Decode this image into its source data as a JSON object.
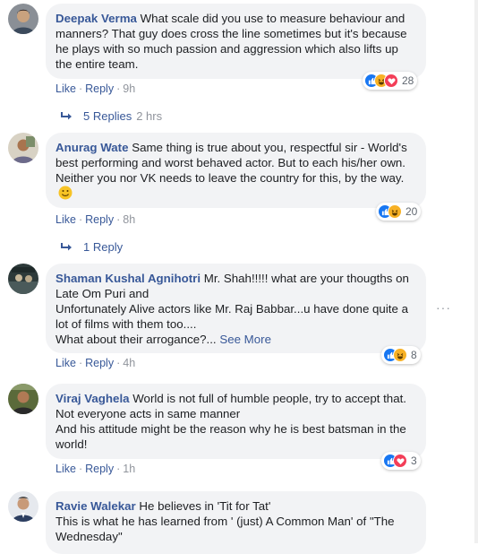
{
  "comments": [
    {
      "author": "Deepak Verma",
      "text": " What scale did you use to measure behaviour and manners? That guy does cross the line sometimes but it's because he plays with so much passion and aggression which also lifts up the entire team.",
      "like": "Like",
      "reply": "Reply",
      "time": "9h",
      "reactions": [
        "like-icon",
        "haha-icon",
        "love-icon"
      ],
      "reaction_count": "28",
      "replies_label": "5 Replies",
      "replies_time": "2 hrs"
    },
    {
      "author": "Anurag Wate",
      "text": " Same thing is true about you, respectful sir - World's best performing and worst behaved actor. But to each his/her own. Neither you nor VK needs to leave the country for this, by the way.",
      "emoji": "smile-emoji-icon",
      "like": "Like",
      "reply": "Reply",
      "time": "8h",
      "reactions": [
        "like-icon",
        "haha-icon"
      ],
      "reaction_count": "20",
      "replies_label": "1 Reply"
    },
    {
      "author": "Shaman Kushal Agnihotri",
      "text": " Mr. Shah!!!!! what are your thougths on Late Om Puri and\nUnfortunately Alive actors like Mr. Raj Babbar...u have done quite a lot of films with them too....\nWhat about their arrogance?...",
      "see_more": "See More",
      "like": "Like",
      "reply": "Reply",
      "time": "4h",
      "reactions": [
        "like-icon",
        "haha-icon"
      ],
      "reaction_count": "8"
    },
    {
      "author": "Viraj Vaghela",
      "text": " World is not full of humble people, try to accept that. Not everyone acts in same manner\nAnd his attitude might be the reason why he is best batsman in the world!",
      "like": "Like",
      "reply": "Reply",
      "time": "1h",
      "reactions": [
        "like-icon",
        "love-icon"
      ],
      "reaction_count": "3"
    },
    {
      "author": "Ravie Walekar",
      "text": " He believes in 'Tit for Tat'\nThis is what he has learned from ' (just) A Common Man' of \"The Wednesday\""
    }
  ],
  "colors": {
    "author": "#385898",
    "bubble": "#f2f3f5",
    "meta": "#90949c",
    "like": "#1877f2",
    "haha": "#f7b125",
    "love": "#f33e58"
  }
}
